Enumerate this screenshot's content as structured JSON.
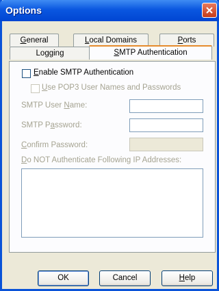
{
  "window": {
    "title": "Options"
  },
  "tabs_back": [
    {
      "label_pre": "",
      "accel": "G",
      "label_post": "eneral"
    },
    {
      "label_pre": "",
      "accel": "L",
      "label_post": "ocal Domains"
    },
    {
      "label_pre": "",
      "accel": "P",
      "label_post": "orts"
    }
  ],
  "tabs_front": [
    {
      "label": "Logging"
    },
    {
      "label_pre": "",
      "accel": "S",
      "label_post": "MTP Authentication"
    }
  ],
  "form": {
    "enable_smtp": {
      "pre": "",
      "accel": "E",
      "post": "nable SMTP Authentication",
      "checked": false
    },
    "use_pop3": {
      "pre": "",
      "accel": "U",
      "post": "se POP3 User Names and Passwords",
      "checked": false
    },
    "smtp_user": {
      "pre": "SMTP User ",
      "accel": "N",
      "post": "ame:",
      "value": ""
    },
    "smtp_password": {
      "pre": "SMTP P",
      "accel": "a",
      "post": "ssword:",
      "value": ""
    },
    "confirm_password": {
      "pre": "",
      "accel": "C",
      "post": "onfirm Password:",
      "value": ""
    },
    "ip_list_label": {
      "pre": "",
      "accel": "D",
      "post": "o NOT Authenticate Following IP Addresses:"
    }
  },
  "buttons": {
    "ok": "OK",
    "cancel": "Cancel",
    "help_pre": "",
    "help_accel": "H",
    "help_post": "elp"
  }
}
